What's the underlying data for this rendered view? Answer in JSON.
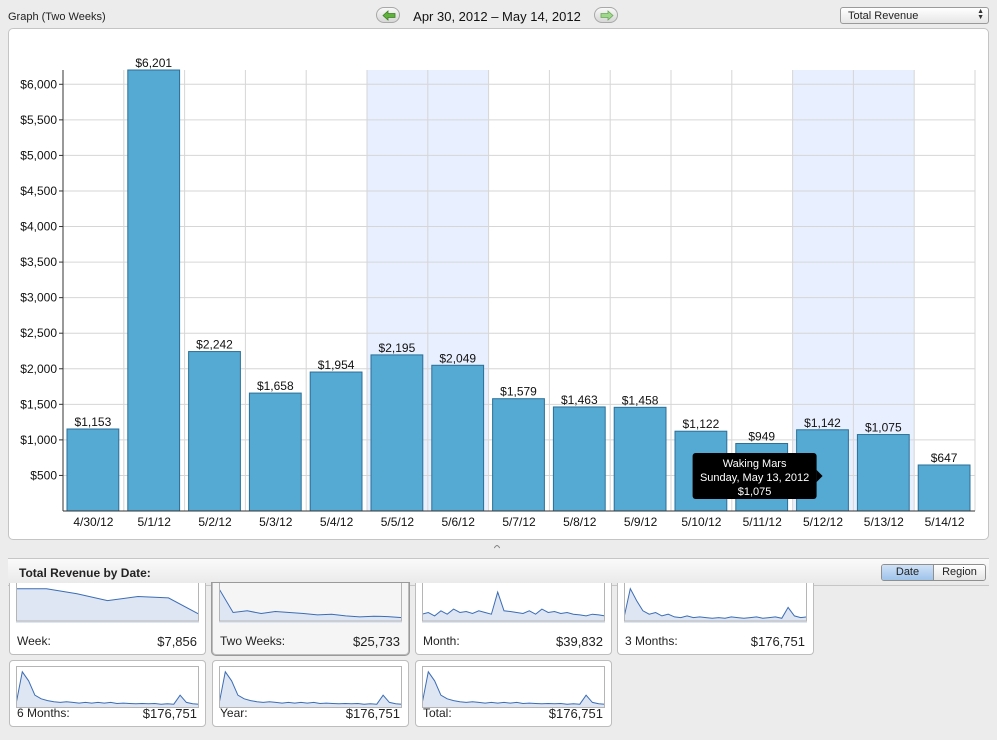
{
  "header": {
    "graph_title": "Graph (Two Weeks)",
    "date_range": "Apr 30, 2012 – May 14, 2012",
    "metric_selected": "Total Revenue",
    "prev_icon": "left-arrow-icon",
    "next_icon": "right-arrow-icon"
  },
  "chart_data": {
    "type": "bar",
    "categories": [
      "4/30/12",
      "5/1/12",
      "5/2/12",
      "5/3/12",
      "5/4/12",
      "5/5/12",
      "5/6/12",
      "5/7/12",
      "5/8/12",
      "5/9/12",
      "5/10/12",
      "5/11/12",
      "5/12/12",
      "5/13/12",
      "5/14/12"
    ],
    "values": [
      1153,
      6201,
      2242,
      1658,
      1954,
      2195,
      2049,
      1579,
      1463,
      1458,
      1122,
      949,
      1142,
      1075,
      647
    ],
    "value_labels": [
      "$1,153",
      "$6,201",
      "$2,242",
      "$1,658",
      "$1,954",
      "$2,195",
      "$2,049",
      "$1,579",
      "$1,463",
      "$1,458",
      "$1,122",
      "$949",
      "$1,142",
      "$1,075",
      "$647"
    ],
    "y_ticks": [
      500,
      1000,
      1500,
      2000,
      2500,
      3000,
      3500,
      4000,
      4500,
      5000,
      5500,
      6000
    ],
    "y_tick_labels": [
      "$500",
      "$1,000",
      "$1,500",
      "$2,000",
      "$2,500",
      "$3,000",
      "$3,500",
      "$4,000",
      "$4,500",
      "$5,000",
      "$5,500",
      "$6,000"
    ],
    "ylim": [
      0,
      6201
    ],
    "weekend_highlight": [
      [
        "5/5/12",
        "5/6/12"
      ],
      [
        "5/12/12",
        "5/13/12"
      ]
    ],
    "grid": true,
    "bar_color": "#55aad3",
    "highlight_color": "#e8efff",
    "tooltip": {
      "category": "5/12/12",
      "line1": "Waking Mars",
      "line2": "Sunday, May 13, 2012",
      "line3": "$1,075"
    }
  },
  "summary": {
    "title": "Total Revenue by Date:",
    "segments": [
      "Date",
      "Region"
    ],
    "active_segment": "Date",
    "cards": [
      {
        "label": "Week:",
        "value": "$7,856",
        "spark": [
          0.95,
          0.95,
          0.8,
          0.6,
          0.72,
          0.68,
          0.2
        ]
      },
      {
        "label": "Two Weeks:",
        "value": "$25,733",
        "spark": [
          0.95,
          0.25,
          0.3,
          0.22,
          0.28,
          0.25,
          0.22,
          0.18,
          0.2,
          0.15,
          0.12,
          0.14,
          0.13,
          0.1
        ]
      },
      {
        "label": "Month:",
        "value": "$39,832",
        "spark": [
          0.2,
          0.25,
          0.15,
          0.3,
          0.2,
          0.35,
          0.25,
          0.28,
          0.22,
          0.3,
          0.25,
          0.2,
          0.85,
          0.3,
          0.28,
          0.25,
          0.22,
          0.3,
          0.2,
          0.35,
          0.25,
          0.28,
          0.22,
          0.25,
          0.2,
          0.18,
          0.15,
          0.2,
          0.18,
          0.15
        ]
      },
      {
        "label": "3 Months:",
        "value": "$176,751",
        "spark": [
          0.1,
          0.95,
          0.6,
          0.3,
          0.2,
          0.25,
          0.15,
          0.2,
          0.12,
          0.1,
          0.15,
          0.1,
          0.12,
          0.1,
          0.08,
          0.1,
          0.08,
          0.12,
          0.1,
          0.08,
          0.1,
          0.12,
          0.08,
          0.1,
          0.12,
          0.08,
          0.4,
          0.15,
          0.1,
          0.12
        ]
      },
      {
        "label": "6 Months:",
        "value": "$176,751",
        "spark": [
          0.05,
          0.95,
          0.7,
          0.3,
          0.2,
          0.15,
          0.12,
          0.1,
          0.12,
          0.1,
          0.08,
          0.1,
          0.08,
          0.1,
          0.08,
          0.1,
          0.07,
          0.08,
          0.07,
          0.06,
          0.07,
          0.06,
          0.07,
          0.05,
          0.06,
          0.05,
          0.3,
          0.1,
          0.06,
          0.05
        ]
      },
      {
        "label": "Year:",
        "value": "$176,751",
        "spark": [
          0.05,
          0.95,
          0.7,
          0.3,
          0.2,
          0.15,
          0.12,
          0.1,
          0.12,
          0.1,
          0.08,
          0.1,
          0.08,
          0.1,
          0.08,
          0.1,
          0.07,
          0.08,
          0.07,
          0.06,
          0.07,
          0.06,
          0.07,
          0.05,
          0.06,
          0.05,
          0.3,
          0.1,
          0.06,
          0.05
        ]
      },
      {
        "label": "Total:",
        "value": "$176,751",
        "spark": [
          0.05,
          0.95,
          0.7,
          0.3,
          0.2,
          0.15,
          0.12,
          0.1,
          0.12,
          0.1,
          0.08,
          0.1,
          0.08,
          0.1,
          0.08,
          0.1,
          0.07,
          0.08,
          0.07,
          0.06,
          0.07,
          0.06,
          0.07,
          0.05,
          0.06,
          0.05,
          0.3,
          0.1,
          0.06,
          0.05
        ]
      }
    ],
    "selected_card": 1
  }
}
